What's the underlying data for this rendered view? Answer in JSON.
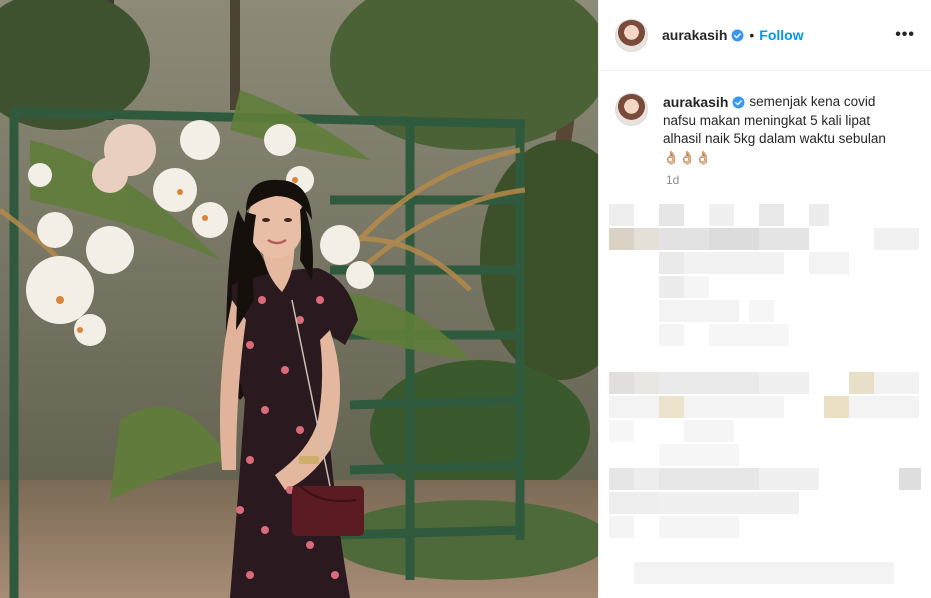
{
  "post": {
    "username": "aurakasih",
    "follow_label": "Follow",
    "more_label": "•••",
    "separator": "•",
    "caption_line1": "semenjak kena covid",
    "caption_line2": "nafsu makan meningkat 5 kali lipat",
    "caption_line3": "alhasil naik 5kg dalam waktu sebulan",
    "caption_emoji": "👌🏼👌🏼👌🏼",
    "time_ago": "1d"
  },
  "colors": {
    "accent": "#0095f6",
    "verified": "#3897f0",
    "text": "#262626",
    "muted": "#8e8e8e"
  },
  "icons": [
    "verified-badge-icon",
    "more-options-icon"
  ]
}
